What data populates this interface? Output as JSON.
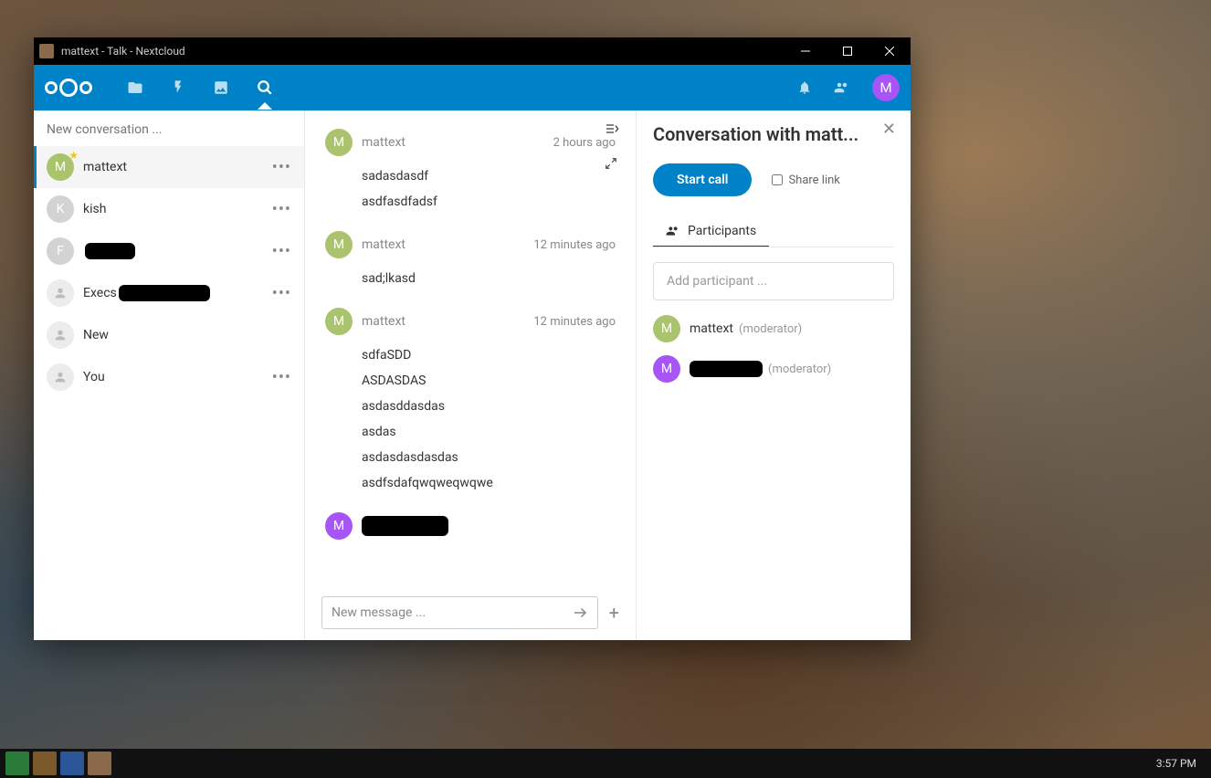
{
  "window": {
    "title": "mattext - Talk - Nextcloud"
  },
  "colors": {
    "accent": "#0082c9",
    "av_green": "#aac36d",
    "av_grey": "#d3d3d3",
    "av_purple": "#a855f7"
  },
  "sidebar": {
    "search_placeholder": "New conversation ...",
    "items": [
      {
        "name": "mattext",
        "av": "M",
        "color": "#aac36d",
        "star": true,
        "dots": true,
        "active": true
      },
      {
        "name": "kish",
        "av": "K",
        "color": "#d3d3d3",
        "dots": true
      },
      {
        "name": "",
        "av": "F",
        "color": "#d3d3d3",
        "dots": true,
        "redacted": true,
        "redact_w": 55
      },
      {
        "name": "Execs",
        "av": "",
        "color": "#ececec",
        "dots": true,
        "redacted": true,
        "redact_w": 100,
        "group": true
      },
      {
        "name": "New",
        "av": "",
        "color": "#ececec",
        "group": true
      },
      {
        "name": "You",
        "av": "",
        "color": "#ececec",
        "dots": true,
        "group": true
      }
    ]
  },
  "chat": {
    "messages": [
      {
        "author": "mattext",
        "av": "M",
        "color": "#aac36d",
        "time": "2 hours ago",
        "lines": [
          "sadasdasdf",
          "asdfasdfadsf"
        ]
      },
      {
        "author": "mattext",
        "av": "M",
        "color": "#aac36d",
        "time": "12 minutes ago",
        "lines": [
          "sad;lkasd"
        ]
      },
      {
        "author": "mattext",
        "av": "M",
        "color": "#aac36d",
        "time": "12 minutes ago",
        "lines": [
          "sdfaSDD",
          "ASDASDAS",
          "asdasddasdas",
          "asdas",
          "asdasdasdasdas",
          "asdfsdafqwqweqwqwe"
        ]
      },
      {
        "author": "",
        "av": "M",
        "color": "#a855f7",
        "redacted": true,
        "lines": []
      }
    ],
    "compose_placeholder": "New message ..."
  },
  "right": {
    "title": "Conversation with matt...",
    "start_call": "Start call",
    "share_link": "Share link",
    "tab_participants": "Participants",
    "add_participant_placeholder": "Add participant ...",
    "participants": [
      {
        "name": "mattext",
        "av": "M",
        "color": "#aac36d",
        "role": "(moderator)"
      },
      {
        "name": "",
        "av": "M",
        "color": "#a855f7",
        "role": "(moderator)",
        "redacted": true
      }
    ]
  },
  "user": {
    "initial": "M"
  },
  "taskbar": {
    "time": "3:57 PM"
  }
}
